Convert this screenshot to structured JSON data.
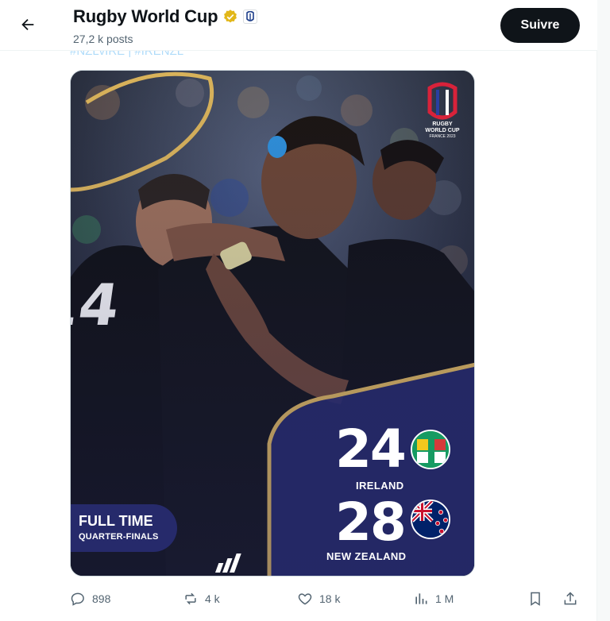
{
  "header": {
    "title": "Rugby World Cup",
    "posts": "27,2 k posts",
    "follow_label": "Suivre"
  },
  "post": {
    "hashtags": "#NZLvIRE | #IRENZL",
    "media": {
      "logo_line1": "RUGBY",
      "logo_line2": "WORLD CUP",
      "logo_line3": "FRANCE 2023",
      "status": "FULL TIME",
      "stage": "QUARTER-FINALS",
      "home_score": "24",
      "home_team": "IRELAND",
      "away_score": "28",
      "away_team": "NEW ZEALAND"
    },
    "stats": {
      "replies": "898",
      "reposts": "4 k",
      "likes": "18 k",
      "views": "1 M"
    }
  },
  "colors": {
    "accent": "#1d9bf0",
    "gold": "#d8b25a",
    "navy": "#262a6b",
    "ireland_green": "#169b62",
    "nz_blue": "#012169"
  },
  "icons": [
    "arrow-left-icon",
    "verified-badge-icon",
    "rugby-logo-icon",
    "reply-icon",
    "repost-icon",
    "like-icon",
    "views-icon",
    "bookmark-icon",
    "share-icon"
  ]
}
